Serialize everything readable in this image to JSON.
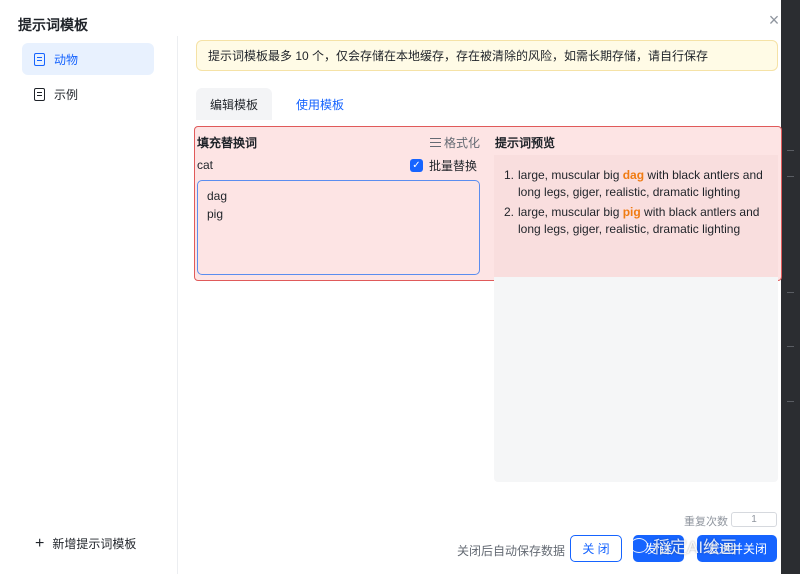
{
  "dialog": {
    "title": "提示词模板",
    "close_glyph": "×"
  },
  "sidebar": {
    "items": [
      {
        "label": "动物",
        "active": true
      },
      {
        "label": "示例",
        "active": false
      }
    ],
    "add_label": "新增提示词模板"
  },
  "notice": {
    "text": "提示词模板最多 10 个，仅会存储在本地缓存，存在被清除的风险，如需长期存储，请自行保存"
  },
  "tabs": [
    {
      "label": "编辑模板",
      "active": false
    },
    {
      "label": "使用模板",
      "active": true
    }
  ],
  "fill": {
    "label": "填充替换词",
    "format_label": "格式化",
    "key_word": "cat",
    "batch_label": "批量替换",
    "batch_checked": true,
    "replace_value": "dag\npig"
  },
  "preview": {
    "label": "提示词预览",
    "items": [
      {
        "num": "1.",
        "before": "large, muscular big ",
        "word": "dag",
        "after": " with black antlers and long legs, giger, realistic, dramatic lighting"
      },
      {
        "num": "2.",
        "before": "large, muscular big ",
        "word": "pig",
        "after": " with black antlers and long legs, giger, realistic, dramatic lighting"
      }
    ]
  },
  "footer": {
    "repeat_label": "重复次数",
    "repeat_value": "1",
    "autosave_note": "关闭后自动保存数据",
    "close_label": "关 闭",
    "send_label": "发 送",
    "send_close_label": "发送并关闭"
  },
  "watermark": {
    "text": "稻定AI绘画"
  },
  "colors": {
    "accent": "#1664ff",
    "highlight_word": "#f07b12",
    "notice_bg": "#fffbe6",
    "annotation_red": "#e05a5a"
  }
}
